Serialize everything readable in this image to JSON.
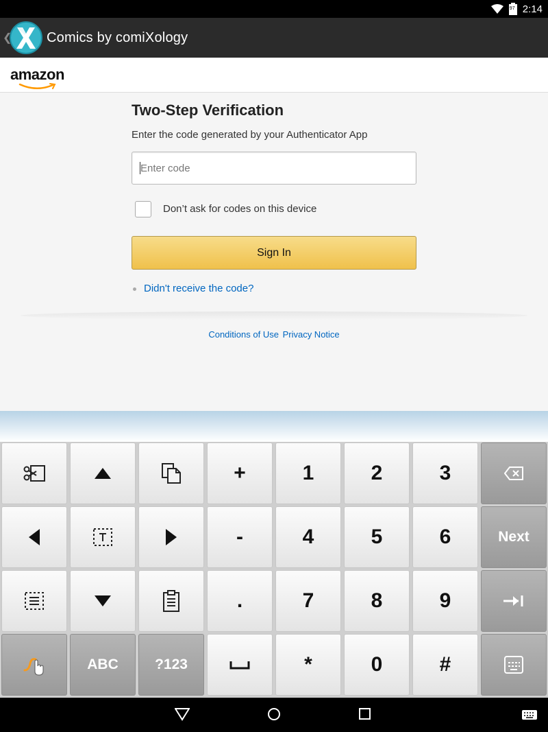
{
  "status_bar": {
    "time": "2:14",
    "battery_percent": "97"
  },
  "app_bar": {
    "title": "Comics by comiXology"
  },
  "brand": {
    "name": "amazon"
  },
  "verification": {
    "title": "Two-Step Verification",
    "subtitle": "Enter the code generated by your Authenticator App",
    "code_placeholder": "Enter code",
    "remember_label": "Don’t ask for codes on this device",
    "remember_checked": false,
    "sign_in_label": "Sign In",
    "resend_link": "Didn't receive the code?"
  },
  "footer": {
    "conditions": "Conditions of Use",
    "privacy": "Privacy Notice"
  },
  "keyboard": {
    "keys": {
      "plus": "+",
      "minus": "-",
      "dot": ".",
      "star": "*",
      "hash": "#",
      "one": "1",
      "two": "2",
      "three": "3",
      "four": "4",
      "five": "5",
      "six": "6",
      "seven": "7",
      "eight": "8",
      "nine": "9",
      "zero": "0",
      "next": "Next",
      "abc": "ABC",
      "sym": "?123"
    },
    "icons": [
      "cut-icon",
      "arrow-up-icon",
      "copy-icon",
      "backspace-icon",
      "arrow-left-icon",
      "select-icon",
      "arrow-right-icon",
      "select-all-icon",
      "arrow-down-icon",
      "paste-icon",
      "tab-icon",
      "swipe-icon",
      "space-icon",
      "keyboard-settings-icon"
    ]
  },
  "colors": {
    "accent_button": "#f0c14b",
    "link": "#0066c0",
    "app_bar": "#2b2b2b"
  }
}
